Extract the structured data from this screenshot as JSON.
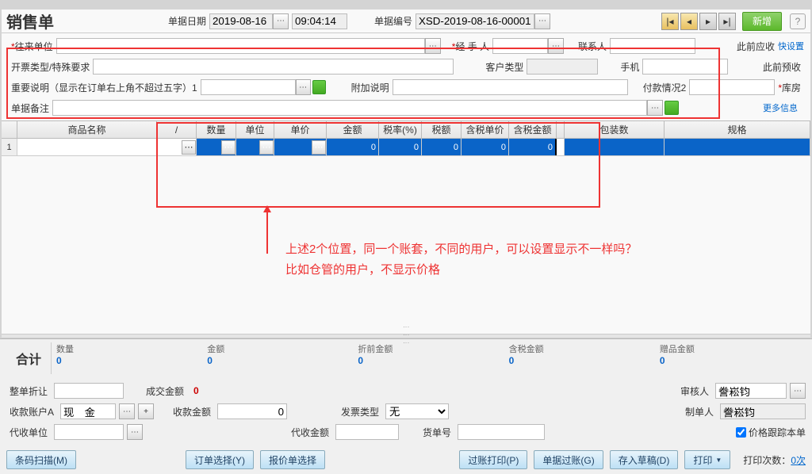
{
  "page_title": "销售单",
  "header": {
    "date_label": "单据日期",
    "date_value": "2019-08-16",
    "time_value": "09:04:14",
    "docno_label": "单据编号",
    "docno_value": "XSD-2019-08-16-00001",
    "add_label": "新增"
  },
  "form": {
    "partner_label": "往来单位",
    "handler_label": "经 手 人",
    "contact_label": "联系人",
    "receivable_label": "此前应收",
    "express_settings": "快设置",
    "invoice_label": "开票类型/特殊要求",
    "cust_type_label": "客户类型",
    "phone_label": "手机",
    "prepay_label": "此前预收",
    "important_label": "重要说明（显示在订单右上角不超过五字）1",
    "attach_label": "附加说明",
    "pay_status_label": "付款情况2",
    "warehouse_label": "库房",
    "memo_label": "单据备注",
    "more_info": "更多信息"
  },
  "grid": {
    "cols": [
      "商品名称",
      "/",
      "数量",
      "单位",
      "单价",
      "金额",
      "税率(%)",
      "税额",
      "含税单价",
      "含税金额",
      "",
      "包装数",
      "规格"
    ],
    "row1": {
      "idx": "1",
      "amt": "0",
      "rate": "0",
      "tax": "0",
      "tprice": "0",
      "tamt": "0"
    }
  },
  "annotation": {
    "line1": "上述2个位置，同一个账套，不同的用户，可以设置显示不一样吗？",
    "line2": "比如仓管的用户，不显示价格"
  },
  "summary": {
    "title": "合计",
    "qty_label": "数量",
    "qty_val": "0",
    "amt_label": "金额",
    "amt_val": "0",
    "pre_label": "折前金额",
    "pre_val": "0",
    "tax_label": "含税金额",
    "tax_val": "0",
    "gift_label": "赠品金额",
    "gift_val": "0"
  },
  "bottom": {
    "discount_label": "整单折让",
    "deal_amt_label": "成交金额",
    "deal_amt_val": "0",
    "auditor_label": "审核人",
    "auditor_val": "誊崧钧",
    "acct_label": "收款账户A",
    "acct_val": "现　金",
    "collect_amt_label": "收款金额",
    "collect_amt_val": "0",
    "inv_type_label": "发票类型",
    "inv_type_val": "无",
    "maker_label": "制单人",
    "maker_val": "誊崧钧",
    "agent_label": "代收单位",
    "agent_amt_label": "代收金额",
    "shipno_label": "货单号",
    "track_cost_label": "价格跟踪本单"
  },
  "actions": {
    "barcode": "条码扫描(M)",
    "order_sel": "订单选择(Y)",
    "quote_sel": "报价单选择",
    "post_print": "过账打印(P)",
    "post": "单据过账(G)",
    "draft": "存入草稿(D)",
    "print": "打印",
    "print_count_label": "打印次数：",
    "print_count_val": "0次"
  }
}
